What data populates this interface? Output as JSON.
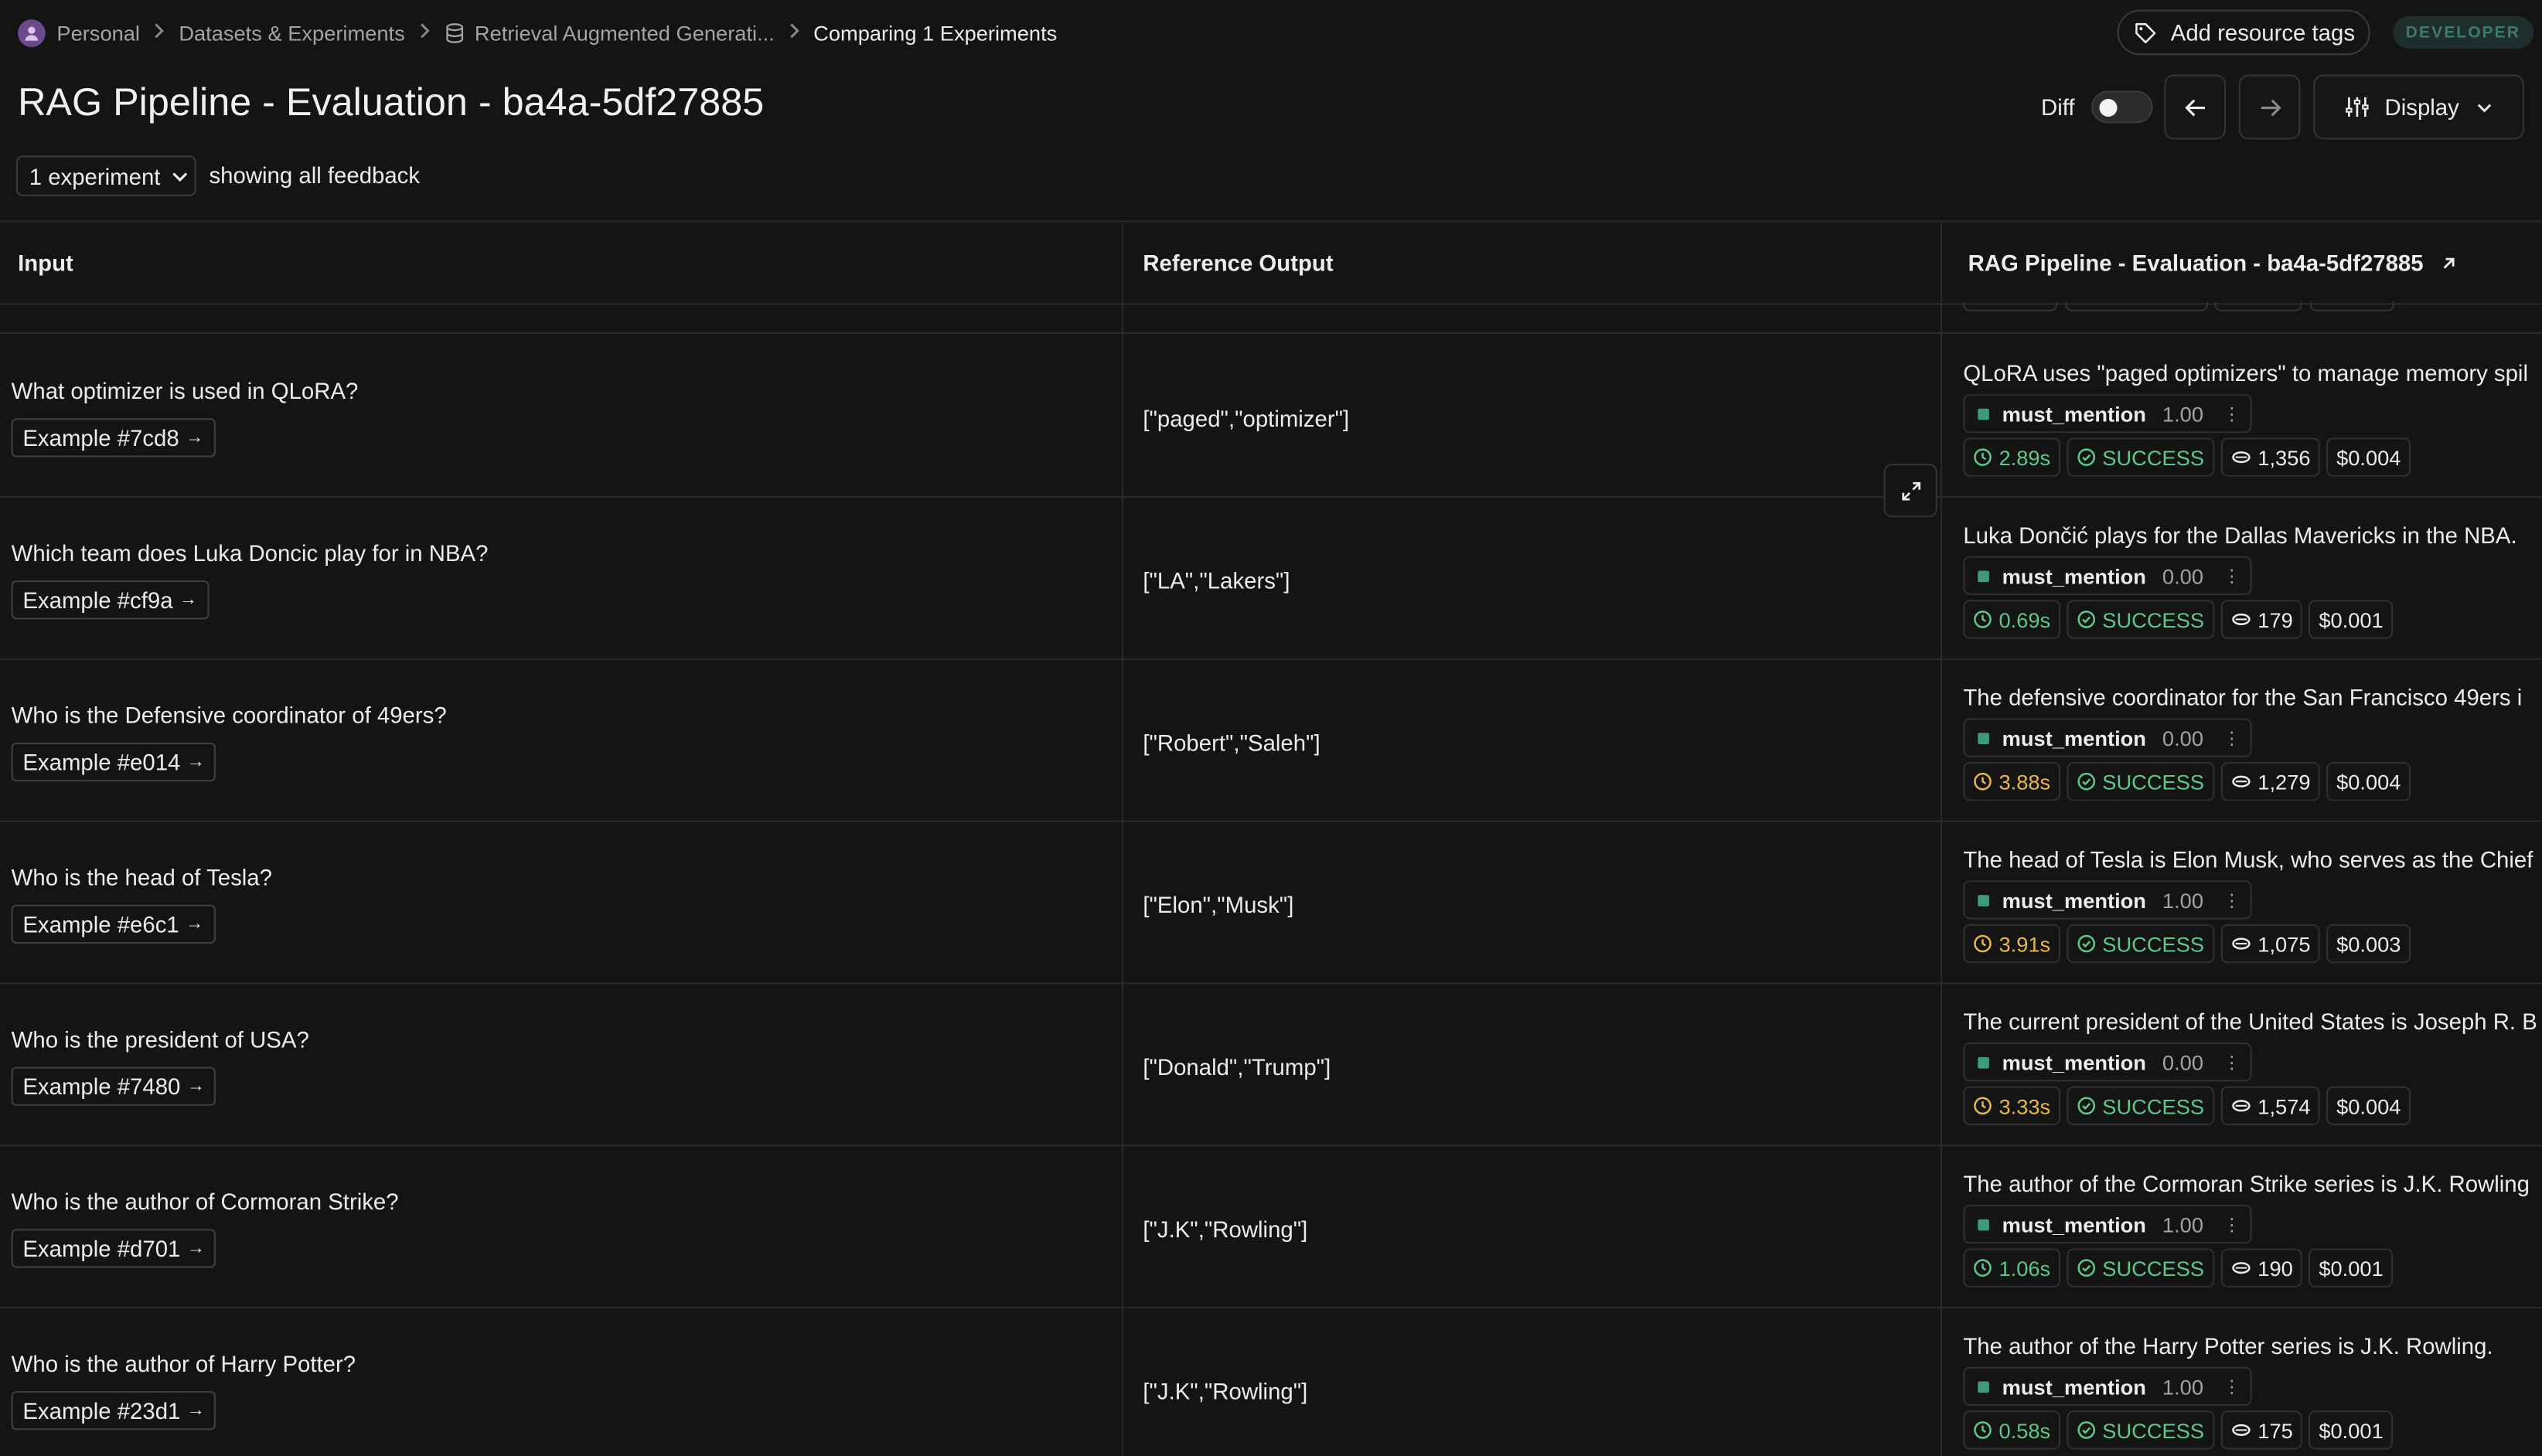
{
  "breadcrumb": {
    "items": [
      "Personal",
      "Datasets & Experiments",
      "Retrieval Augmented Generati...",
      "Comparing 1 Experiments"
    ]
  },
  "header": {
    "add_tags_label": "Add resource tags",
    "env_badge": "DEVELOPER",
    "title": "RAG Pipeline - Evaluation - ba4a-5df27885",
    "diff_label": "Diff",
    "diff_enabled": false,
    "display_label": "Display"
  },
  "filters": {
    "experiment_count": "1 experiment",
    "feedback_text": "showing all feedback"
  },
  "table": {
    "columns": {
      "input": "Input",
      "reference": "Reference Output",
      "experiment": "RAG Pipeline - Evaluation - ba4a-5df27885"
    },
    "rows": [
      {
        "question": "What optimizer is used in QLoRA?",
        "example": "Example #7cd8",
        "reference": "[\"paged\",\"optimizer\"]",
        "output": "QLoRA uses \"paged optimizers\" to manage memory spil",
        "feedback_key": "must_mention",
        "feedback_score": "1.00",
        "latency": "2.89s",
        "latency_level": "fast",
        "status": "SUCCESS",
        "tokens": "1,356",
        "cost": "$0.004"
      },
      {
        "question": "Which team does Luka Doncic play for in NBA?",
        "example": "Example #cf9a",
        "reference": "[\"LA\",\"Lakers\"]",
        "output": "Luka Dončić plays for the Dallas Mavericks in the NBA.",
        "feedback_key": "must_mention",
        "feedback_score": "0.00",
        "latency": "0.69s",
        "latency_level": "fast",
        "status": "SUCCESS",
        "tokens": "179",
        "cost": "$0.001"
      },
      {
        "question": "Who is the Defensive coordinator of 49ers?",
        "example": "Example #e014",
        "reference": "[\"Robert\",\"Saleh\"]",
        "output": "The defensive coordinator for the San Francisco 49ers i",
        "feedback_key": "must_mention",
        "feedback_score": "0.00",
        "latency": "3.88s",
        "latency_level": "slow",
        "status": "SUCCESS",
        "tokens": "1,279",
        "cost": "$0.004"
      },
      {
        "question": "Who is the head of Tesla?",
        "example": "Example #e6c1",
        "reference": "[\"Elon\",\"Musk\"]",
        "output": "The head of Tesla is Elon Musk, who serves as the Chief",
        "feedback_key": "must_mention",
        "feedback_score": "1.00",
        "latency": "3.91s",
        "latency_level": "slow",
        "status": "SUCCESS",
        "tokens": "1,075",
        "cost": "$0.003"
      },
      {
        "question": "Who is the president of USA?",
        "example": "Example #7480",
        "reference": "[\"Donald\",\"Trump\"]",
        "output": "The current president of the United States is Joseph R. B",
        "feedback_key": "must_mention",
        "feedback_score": "0.00",
        "latency": "3.33s",
        "latency_level": "slow",
        "status": "SUCCESS",
        "tokens": "1,574",
        "cost": "$0.004"
      },
      {
        "question": "Who is the author of Cormoran Strike?",
        "example": "Example #d701",
        "reference": "[\"J.K\",\"Rowling\"]",
        "output": "The author of the Cormoran Strike series is J.K. Rowling",
        "feedback_key": "must_mention",
        "feedback_score": "1.00",
        "latency": "1.06s",
        "latency_level": "fast",
        "status": "SUCCESS",
        "tokens": "190",
        "cost": "$0.001"
      },
      {
        "question": "Who is the author of Harry Potter?",
        "example": "Example #23d1",
        "reference": "[\"J.K\",\"Rowling\"]",
        "output": "The author of the Harry Potter series is J.K. Rowling.",
        "feedback_key": "must_mention",
        "feedback_score": "1.00",
        "latency": "0.58s",
        "latency_level": "fast",
        "status": "SUCCESS",
        "tokens": "175",
        "cost": "$0.001"
      }
    ]
  },
  "colors": {
    "background": "#141414",
    "border": "#2a2a2a",
    "success": "#5cc98a",
    "warning_latency": "#e6b84a",
    "feedback_dot": "#3f9a7a",
    "badge_text": "#3e7a72"
  },
  "icons": [
    "user-avatar-icon",
    "chevron-right-icon",
    "database-icon",
    "tag-icon",
    "arrow-left-icon",
    "arrow-right-icon",
    "sliders-icon",
    "chevron-down-icon",
    "external-link-icon",
    "expand-icon",
    "clock-icon",
    "check-circle-icon",
    "token-icon",
    "kebab-icon"
  ]
}
